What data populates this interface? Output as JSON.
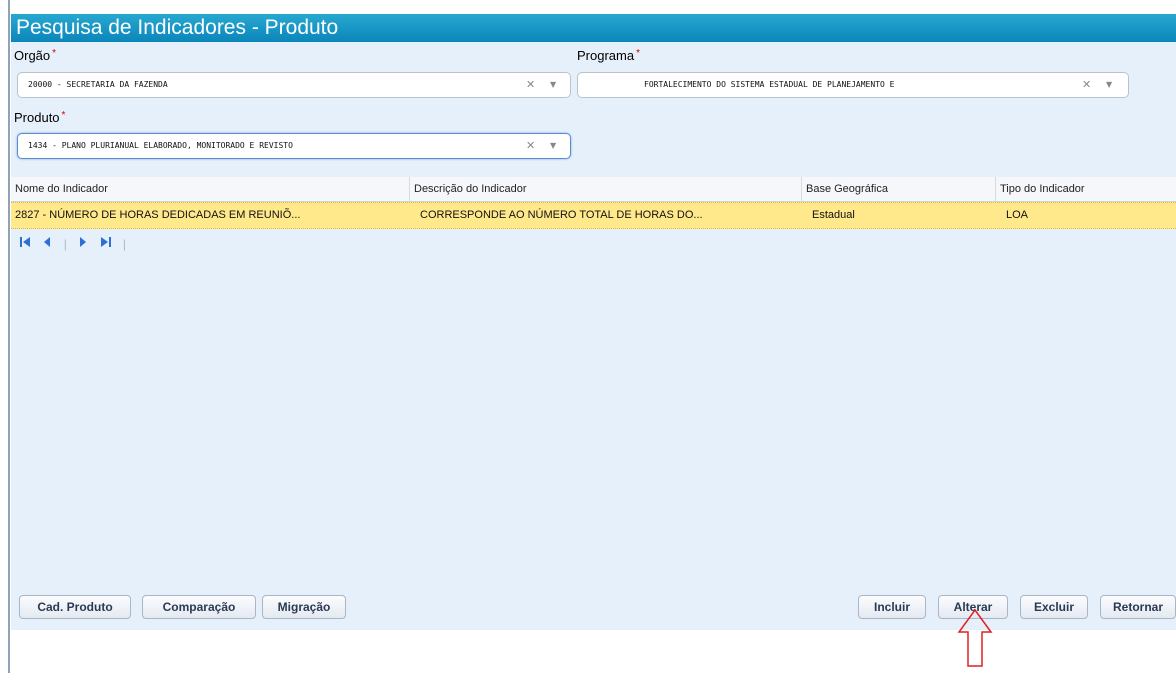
{
  "window": {
    "title": "Pesquisa de Indicadores - Produto"
  },
  "filters": {
    "orgao": {
      "label": "Orgão",
      "required_mark": "*",
      "value": "20000 - SECRETARIA DA FAZENDA",
      "clear_icon": "✕",
      "dropdown_icon": "▼"
    },
    "programa": {
      "label": "Programa",
      "required_mark": "*",
      "value": "FORTALECIMENTO DO SISTEMA ESTADUAL DE PLANEJAMENTO E",
      "clear_icon": "✕",
      "dropdown_icon": "▼"
    },
    "produto": {
      "label": "Produto",
      "required_mark": "*",
      "value": "1434 - PLANO PLURIANUAL ELABORADO, MONITORADO E REVISTO",
      "clear_icon": "✕",
      "dropdown_icon": "▼"
    }
  },
  "grid": {
    "columns": [
      "Nome do Indicador",
      "Descrição do Indicador",
      "Base Geográfica",
      "Tipo do Indicador"
    ],
    "rows": [
      {
        "nome": "2827 - NÚMERO DE HORAS DEDICADAS EM REUNIÕ...",
        "descricao": "CORRESPONDE AO NÚMERO TOTAL DE HORAS DO...",
        "base": "Estadual",
        "tipo": "LOA"
      }
    ]
  },
  "pager": {
    "first_icon": "first-page-icon",
    "prev_icon": "prev-page-icon",
    "next_icon": "next-page-icon",
    "last_icon": "last-page-icon"
  },
  "buttons_left": {
    "cad_produto": "Cad. Produto",
    "comparacao": "Comparação",
    "migracao": "Migração"
  },
  "buttons_right": {
    "incluir": "Incluir",
    "alterar": "Alterar",
    "excluir": "Excluir",
    "retornar": "Retornar"
  },
  "annotation": {
    "icon": "up-arrow-outline-icon",
    "color": "#e02020"
  }
}
